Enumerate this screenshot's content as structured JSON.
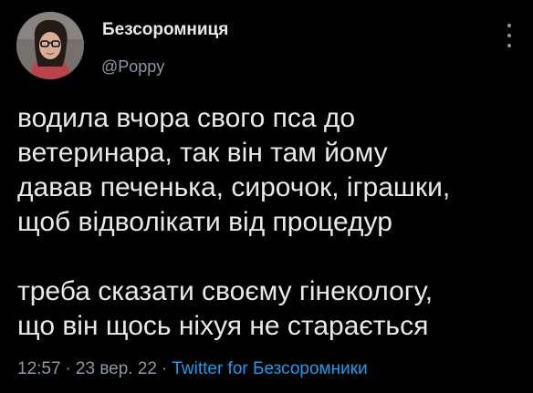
{
  "author": {
    "display_name": "Безсоромниця",
    "handle": "@Poppy",
    "avatar_icon": "user-avatar-photo"
  },
  "more_icon": "more-vertical-icon",
  "tweet": {
    "paragraph1": [
      "водила вчора свого пса до",
      "ветеринара, так він там йому",
      "давав печенька, сирочок, іграшки,",
      "щоб відволікати від процедур"
    ],
    "paragraph2": [
      "треба сказати своєму гінекологу,",
      "що він щось ніхуя не старається"
    ]
  },
  "meta": {
    "time": "12:57",
    "separator": "·",
    "date": "23 вер. 22",
    "source": "Twitter for Безсоромники"
  },
  "colors": {
    "background": "#000000",
    "text": "#e7e9ea",
    "secondary": "#8b98a5",
    "link": "#1d9bf0"
  }
}
